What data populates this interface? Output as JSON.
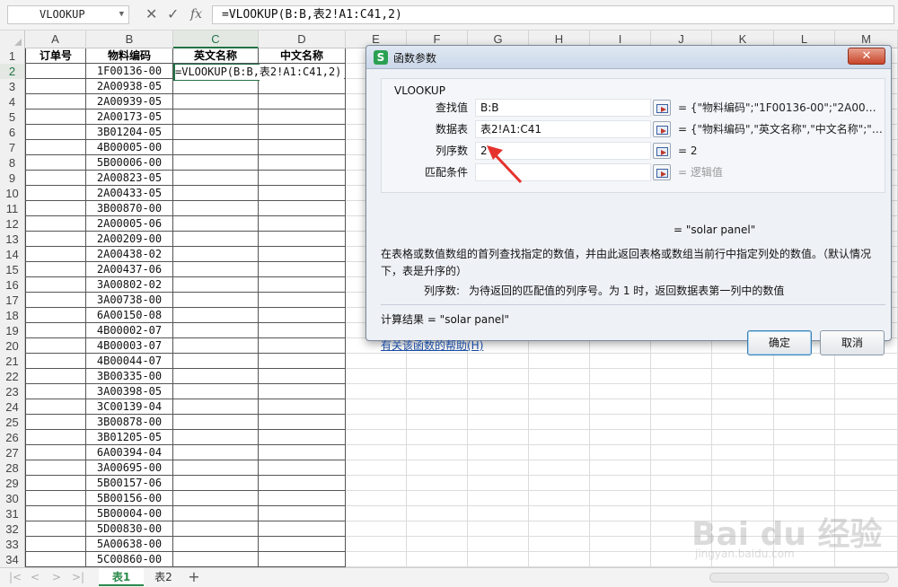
{
  "formula_bar": {
    "name_box": "VLOOKUP",
    "formula": "=VLOOKUP(B:B,表2!A1:C41,2)",
    "icons": [
      "cancel-icon",
      "confirm-icon",
      "fx-icon"
    ]
  },
  "columns": [
    "A",
    "B",
    "C",
    "D",
    "E",
    "F",
    "G",
    "H",
    "I",
    "J",
    "K",
    "L",
    "M"
  ],
  "selected_column": "C",
  "headers": {
    "A": "订单号",
    "B": "物料编码",
    "C": "英文名称",
    "D": "中文名称"
  },
  "active_cell_formula": "=VLOOKUP(B:B,表2!A1:C41,2)",
  "rows": [
    {
      "n": "1"
    },
    {
      "n": "2",
      "b": "1F00136-00"
    },
    {
      "n": "3",
      "b": "2A00938-05"
    },
    {
      "n": "4",
      "b": "2A00939-05"
    },
    {
      "n": "5",
      "b": "2A00173-05"
    },
    {
      "n": "6",
      "b": "3B01204-05"
    },
    {
      "n": "7",
      "b": "4B00005-00"
    },
    {
      "n": "8",
      "b": "5B00006-00"
    },
    {
      "n": "9",
      "b": "2A00823-05"
    },
    {
      "n": "10",
      "b": "2A00433-05"
    },
    {
      "n": "11",
      "b": "3B00870-00"
    },
    {
      "n": "12",
      "b": "2A00005-06"
    },
    {
      "n": "13",
      "b": "2A00209-00"
    },
    {
      "n": "14",
      "b": "2A00438-02"
    },
    {
      "n": "15",
      "b": "2A00437-06"
    },
    {
      "n": "16",
      "b": "3A00802-02"
    },
    {
      "n": "17",
      "b": "3A00738-00"
    },
    {
      "n": "18",
      "b": "6A00150-08"
    },
    {
      "n": "19",
      "b": "4B00002-07"
    },
    {
      "n": "20",
      "b": "4B00003-07"
    },
    {
      "n": "21",
      "b": "4B00044-07"
    },
    {
      "n": "22",
      "b": "3B00335-00"
    },
    {
      "n": "23",
      "b": "3A00398-05"
    },
    {
      "n": "24",
      "b": "3C00139-04"
    },
    {
      "n": "25",
      "b": "3B00878-00"
    },
    {
      "n": "26",
      "b": "3B01205-05"
    },
    {
      "n": "27",
      "b": "6A00394-04"
    },
    {
      "n": "28",
      "b": "3A00695-00"
    },
    {
      "n": "29",
      "b": "5B00157-06"
    },
    {
      "n": "30",
      "b": "5B00156-00"
    },
    {
      "n": "31",
      "b": "5B00004-00"
    },
    {
      "n": "32",
      "b": "5D00830-00"
    },
    {
      "n": "33",
      "b": "5A00638-00"
    },
    {
      "n": "34",
      "b": "5C00860-00"
    }
  ],
  "sheet_tabs": {
    "tab1": "表1",
    "tab2": "表2",
    "add": "+"
  },
  "dialog": {
    "title": "函数参数",
    "logo": "S",
    "close": "✕",
    "group_title": "VLOOKUP",
    "params": [
      {
        "label": "查找值",
        "value": "B:B",
        "result": "= {\"物料编码\";\"1F00136-00\";\"2A00938-05...",
        "dim": false
      },
      {
        "label": "数据表",
        "value": "表2!A1:C41",
        "result": "= {\"物料编码\",\"英文名称\",\"中文名称\";\"5C0...",
        "dim": false
      },
      {
        "label": "列序数",
        "value": "2",
        "result": "= 2",
        "dim": false
      },
      {
        "label": "匹配条件",
        "value": "",
        "result": "= 逻辑值",
        "dim": true
      }
    ],
    "overall_result": "= \"solar panel\"",
    "description": "在表格或数值数组的首列查找指定的数值，并由此返回表格或数组当前行中指定列处的数值。（默认情况下，表是升序的）",
    "arg_name": "列序数:",
    "arg_description": "为待返回的匹配值的列序号。为 1 时，返回数据表第一列中的数值",
    "calc_result": "计算结果 = \"solar panel\"",
    "help_link": "有关该函数的帮助(H)",
    "ok": "确定",
    "cancel": "取消"
  },
  "watermark": {
    "text": "Bai du 经验",
    "sub": "jingyan.baidu.com"
  }
}
